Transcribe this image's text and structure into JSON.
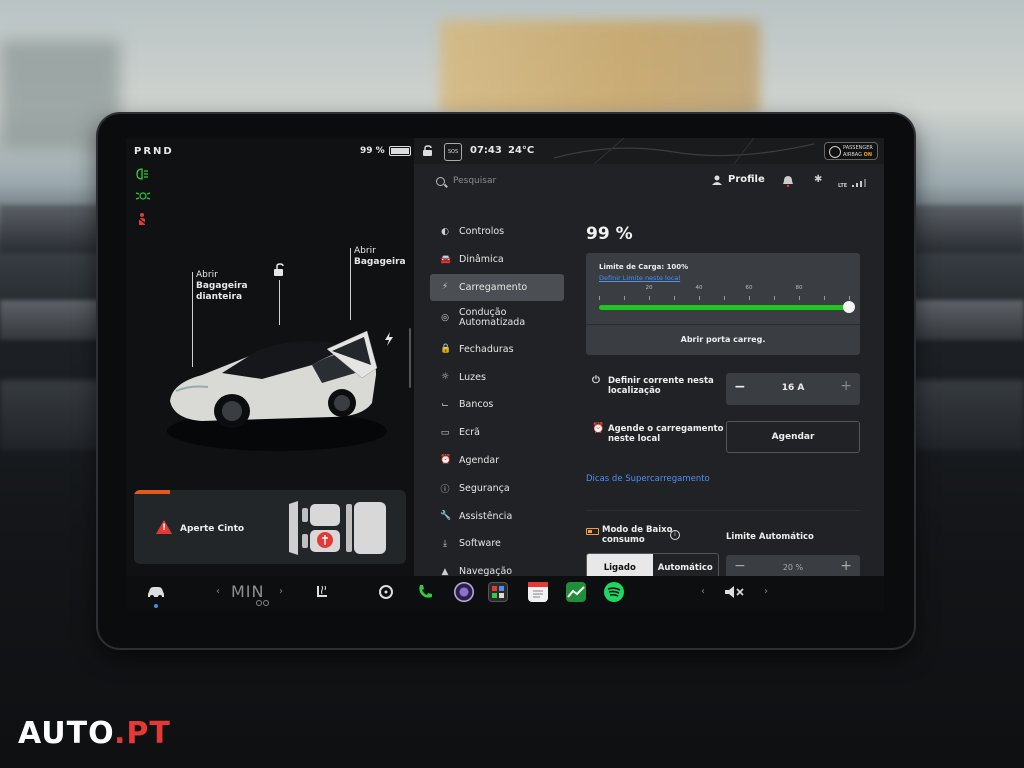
{
  "left": {
    "gear": "PRND",
    "battery": "99 %",
    "battery_pct": 99,
    "label_front": "Abrir",
    "label_front_bold1": "Bagageira",
    "label_front_bold2": "dianteira",
    "label_rear": "Abrir",
    "label_rear_bold": "Bagageira",
    "alert_text": "Aperte Cinto",
    "colors": {
      "headlight": "#2ecc40",
      "seatbelt_warn": "#e53935",
      "alert_bar": "#e35a1d"
    }
  },
  "topbar": {
    "sos": "SOS",
    "time": "07:43",
    "temp": "24°C",
    "airbag_line1": "PASSENGER",
    "airbag_line2": "AIRBAG",
    "airbag_state": "ON"
  },
  "header": {
    "search_placeholder": "Pesquisar",
    "profile": "Profile",
    "lte": "LTE"
  },
  "menu": [
    {
      "label": "Controlos",
      "icon": "toggle-icon"
    },
    {
      "label": "Dinâmica",
      "icon": "car-icon"
    },
    {
      "label": "Carregamento",
      "icon": "bolt-icon",
      "selected": true
    },
    {
      "label": "Condução",
      "label2": "Automatizada",
      "icon": "steering-wheel-icon"
    },
    {
      "label": "Fechaduras",
      "icon": "lock-icon"
    },
    {
      "label": "Luzes",
      "icon": "sun-icon"
    },
    {
      "label": "Bancos",
      "icon": "seat-icon"
    },
    {
      "label": "Ecrã",
      "icon": "screen-icon"
    },
    {
      "label": "Agendar",
      "icon": "alarm-icon"
    },
    {
      "label": "Segurança",
      "icon": "info-icon"
    },
    {
      "label": "Assistência",
      "icon": "wrench-icon"
    },
    {
      "label": "Software",
      "icon": "download-icon"
    },
    {
      "label": "Navegação",
      "icon": "navigation-icon"
    }
  ],
  "charging": {
    "level": "99 %",
    "limit_label": "Limite de Carga: 100%",
    "limit_pct": 100,
    "set_local_link": "Definir Limite neste local",
    "ticks": [
      "20",
      "40",
      "60",
      "80"
    ],
    "open_port": "Abrir porta carreg.",
    "current_label_1": "Definir corrente nesta",
    "current_label_2": "localização",
    "current_value": "16 A",
    "schedule_label_1": "Agende o carregamento",
    "schedule_label_2": "neste local",
    "schedule_button": "Agendar",
    "supercharge_link": "Dicas de Supercarregamento",
    "low_power_1": "Modo de Baixo",
    "low_power_2": "consumo",
    "auto_limit": "Limite Automático",
    "seg_on": "Ligado",
    "seg_auto": "Automático",
    "auto_limit_value": "20 %",
    "colors": {
      "slider": "#22c422",
      "link": "#4f8ff2",
      "accent": "#f2a03b"
    }
  },
  "dock": {
    "min_label": "MIN"
  },
  "logo": {
    "part1": "AUTO",
    "part2": ".PT"
  }
}
